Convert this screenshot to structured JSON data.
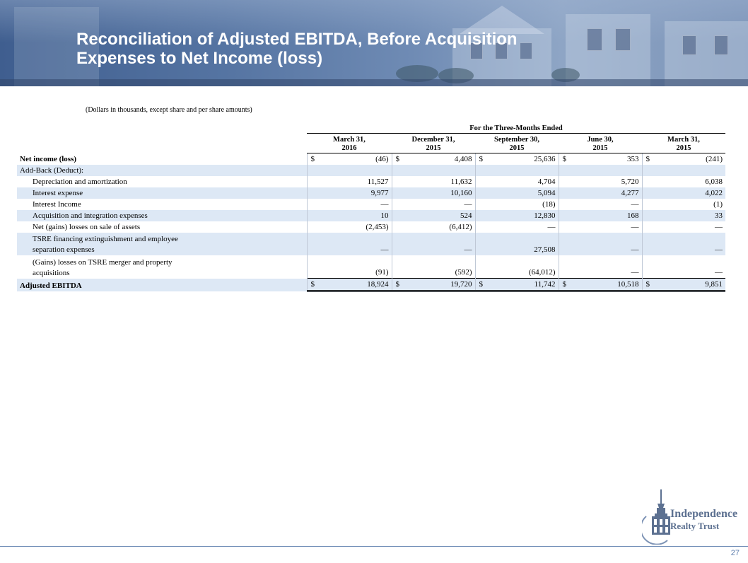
{
  "header": {
    "title": "Reconciliation of Adjusted EBITDA, Before Acquisition\nExpenses to Net Income (loss)"
  },
  "subtitle": "(Dollars in thousands, except share and per share amounts)",
  "table": {
    "group_header": "For the Three-Months Ended",
    "columns": [
      "March 31,\n2016",
      "December 31,\n2015",
      "September 30,\n2015",
      "June 30,\n2015",
      "March 31,\n2015"
    ],
    "currency_symbol": "$",
    "rows": {
      "net_income": {
        "label": "Net income (loss)",
        "values": [
          "(46)",
          "4,408",
          "25,636",
          "353",
          "(241)"
        ]
      },
      "add_back": {
        "label": "Add-Back (Deduct):"
      },
      "depreciation": {
        "label": "Depreciation and amortization",
        "values": [
          "11,527",
          "11,632",
          "4,704",
          "5,720",
          "6,038"
        ]
      },
      "interest_expense": {
        "label": "Interest expense",
        "values": [
          "9,977",
          "10,160",
          "5,094",
          "4,277",
          "4,022"
        ]
      },
      "interest_income": {
        "label": "Interest Income",
        "values": [
          "—",
          "—",
          "(18)",
          "—",
          "(1)"
        ]
      },
      "acquisition": {
        "label": "Acquisition and integration expenses",
        "values": [
          "10",
          "524",
          "12,830",
          "168",
          "33"
        ]
      },
      "net_gains": {
        "label": "Net (gains) losses on sale of assets",
        "values": [
          "(2,453)",
          "(6,412)",
          "—",
          "—",
          "—"
        ]
      },
      "tsre_financing": {
        "label": "TSRE financing extinguishment and employee\n   separation expenses",
        "values": [
          "—",
          "—",
          "27,508",
          "—",
          "—"
        ]
      },
      "tsre_merger": {
        "label": "(Gains) losses on TSRE merger and property\n   acquisitions",
        "values": [
          "(91)",
          "(592)",
          "(64,012)",
          "—",
          "—"
        ]
      },
      "adjusted_ebitda": {
        "label": "Adjusted EBITDA",
        "values": [
          "18,924",
          "19,720",
          "11,742",
          "10,518",
          "9,851"
        ]
      }
    }
  },
  "footer": {
    "page_number": "27",
    "logo_line1": "Independence",
    "logo_line2": "Realty Trust"
  },
  "colors": {
    "banner": "#4f6e9f",
    "row_shade": "#dde8f5",
    "logo_text": "#5d7191",
    "page_number": "#5f7fae"
  }
}
